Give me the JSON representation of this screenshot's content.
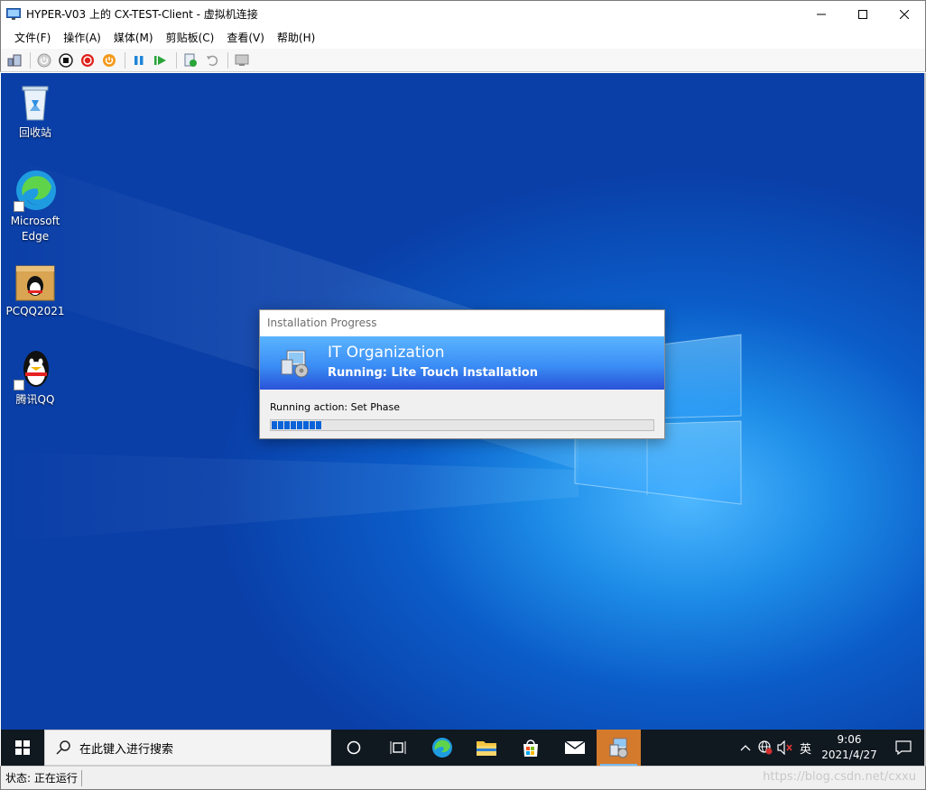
{
  "window": {
    "title": "HYPER-V03 上的 CX-TEST-Client - 虚拟机连接"
  },
  "menu": {
    "items": [
      "文件(F)",
      "操作(A)",
      "媒体(M)",
      "剪贴板(C)",
      "查看(V)",
      "帮助(H)"
    ]
  },
  "toolbar": {
    "icons": [
      "ctrl-alt-del-icon",
      "start-icon",
      "turn-off-icon",
      "shutdown-icon",
      "save-icon",
      "pause-icon",
      "reset-icon",
      "checkpoint-icon",
      "revert-icon",
      "enhanced-session-icon"
    ]
  },
  "desktop": {
    "icons": [
      {
        "label": "回收站",
        "icon": "recycle-bin-icon"
      },
      {
        "label": "Microsoft Edge",
        "icon": "edge-icon"
      },
      {
        "label": "PCQQ2021",
        "icon": "qq-installer-icon"
      },
      {
        "label": "腾讯QQ",
        "icon": "qq-icon"
      }
    ]
  },
  "dialog": {
    "title": "Installation Progress",
    "organization": "IT Organization",
    "running": "Running: Lite Touch Installation",
    "action": "Running action: Set Phase",
    "progress_segments": 8
  },
  "taskbar": {
    "search_placeholder": "在此键入进行搜索",
    "ime": "英",
    "time": "9:06",
    "date": "2021/4/27"
  },
  "status": {
    "text": "状态: 正在运行"
  },
  "watermark": "https://blog.csdn.net/cxxu"
}
